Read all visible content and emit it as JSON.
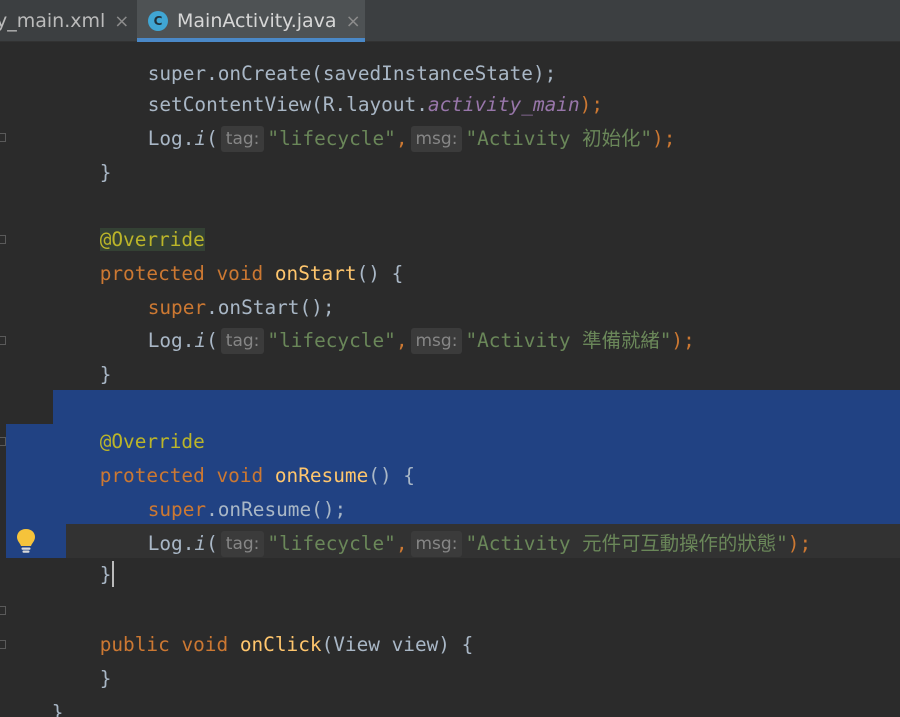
{
  "tabs": [
    {
      "label": "y_main.xml",
      "close": "×",
      "active": false
    },
    {
      "label": "MainActivity.java",
      "icon": "C",
      "close": "×",
      "active": true
    }
  ],
  "code": {
    "l0": "super.onCreate(savedInstanceState);",
    "l1": {
      "a": "setContentView(R.layout.",
      "b": "activity_main",
      "c": ");"
    },
    "log_prefix": "Log.",
    "log_method": "i",
    "tag_hint": "tag:",
    "msg_hint": "msg:",
    "tag_value": "\"lifecycle\"",
    "comma": ",",
    "l2_msg": "\"Activity 初始化\"",
    "close_brace": "}",
    "override": "@Override",
    "protected": "protected",
    "void": "void",
    "public": "public",
    "super": "super",
    "on_start": "onStart",
    "on_start_call": ".onStart();",
    "l7_msg": "\"Activity 準備就緒\"",
    "on_resume": "onResume",
    "on_resume_call": ".onResume();",
    "l13_msg": "\"Activity 元件可互動操作的狀態\"",
    "on_click": "onClick",
    "on_click_params": "(View view) {",
    "paren_brace": "() {",
    "end_stmt": ");"
  }
}
